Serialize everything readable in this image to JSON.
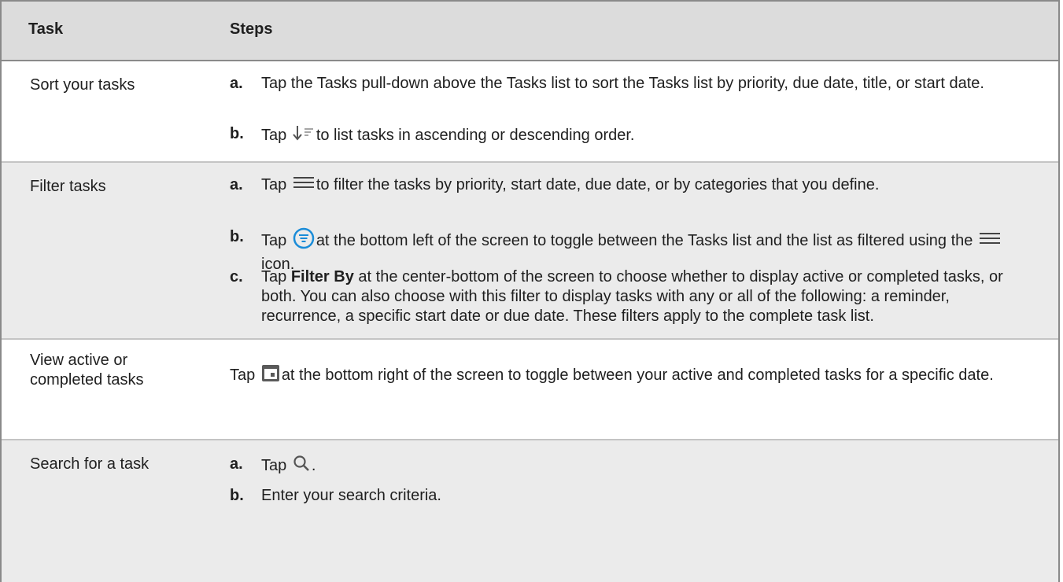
{
  "header": {
    "task": "Task",
    "steps": "Steps"
  },
  "rows": [
    {
      "task": "Sort your tasks",
      "steps": [
        {
          "label": "a.",
          "text": "Tap the Tasks pull-down above the Tasks list to sort the Tasks list by priority, due date, title, or start date."
        },
        {
          "label": "b.",
          "pre": "Tap",
          "icon": "sort-order-icon",
          "post": "to list tasks in ascending or descending order."
        }
      ]
    },
    {
      "task": "Filter tasks",
      "steps": [
        {
          "label": "a.",
          "pre": "Tap",
          "icon": "hamburger-filter-icon",
          "post": "to filter the tasks by priority, start date, due date, or by categories that you define."
        },
        {
          "label": "b.",
          "pre": "Tap",
          "icon": "filter-circle-icon",
          "post": "at the bottom left of the screen to toggle between the Tasks list and the list as filtered using the",
          "icon2": "hamburger-filter-icon",
          "post2": "icon."
        },
        {
          "label": "c.",
          "pre": "Tap",
          "bold": "Filter By",
          "post": "at the center-bottom of the screen to choose whether to display active or completed tasks, or both. You can also choose with this filter to display tasks with any or all of the following: a reminder, recurrence, a specific start date or due date. These filters apply to the complete task list."
        }
      ]
    },
    {
      "task": "View active or completed tasks",
      "steps": [
        {
          "label": "",
          "pre": "Tap",
          "icon": "calendar-icon",
          "post": "at the bottom right of the screen to toggle between your active and completed tasks for a specific date."
        }
      ]
    },
    {
      "task": "Search for a task",
      "steps": [
        {
          "label": "a.",
          "pre": "Tap",
          "icon": "search-icon",
          "post": "."
        },
        {
          "label": "b.",
          "text": "Enter your search criteria."
        }
      ]
    }
  ],
  "colors": {
    "header_bg": "#dcdcdc",
    "alt_row_bg": "#ebebeb",
    "accent_blue": "#1a8cd8",
    "icon_gray": "#666666"
  }
}
